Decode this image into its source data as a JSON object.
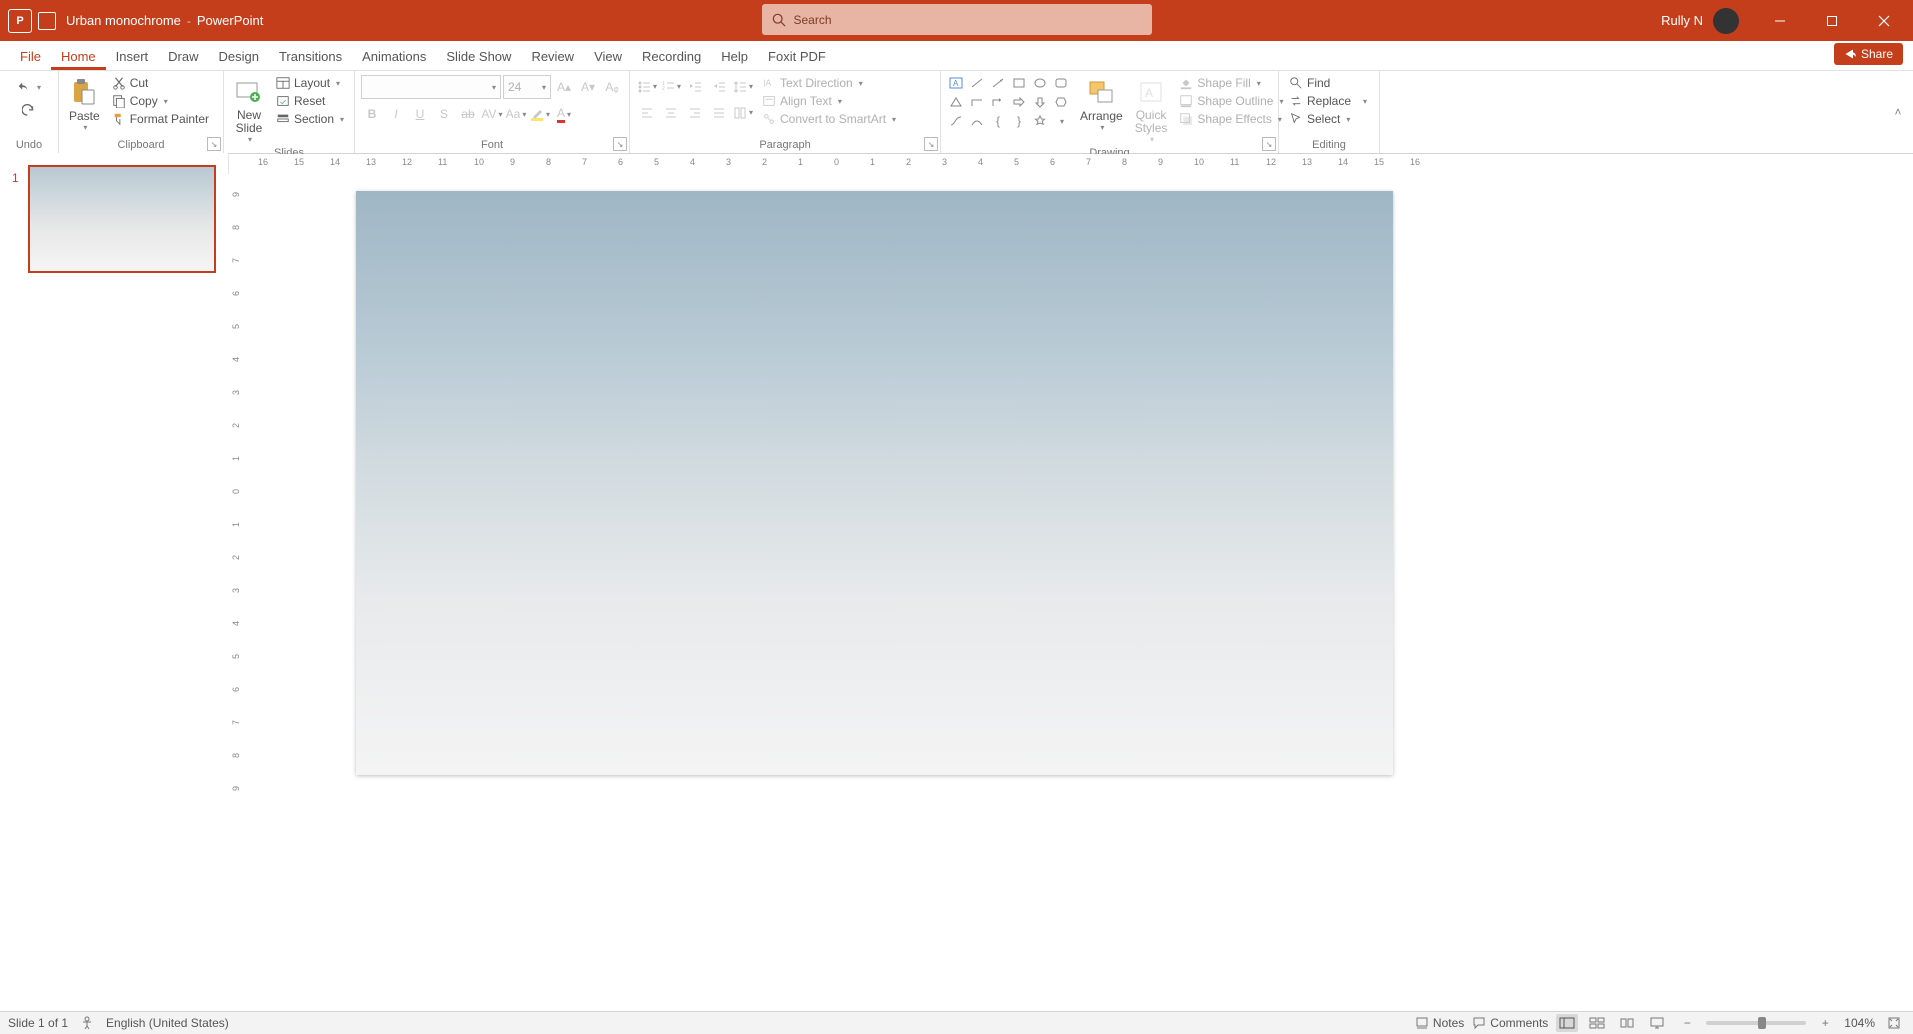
{
  "titlebar": {
    "doc_title": "Urban monochrome",
    "sep": "-",
    "app_name": "PowerPoint",
    "search_placeholder": "Search",
    "user": "Rully N"
  },
  "tabs": {
    "file": "File",
    "home": "Home",
    "insert": "Insert",
    "draw": "Draw",
    "design": "Design",
    "transitions": "Transitions",
    "animations": "Animations",
    "slideshow": "Slide Show",
    "review": "Review",
    "view": "View",
    "recording": "Recording",
    "help": "Help",
    "foxit": "Foxit PDF",
    "share": "Share"
  },
  "ribbon": {
    "undo_label": "Undo",
    "clipboard": {
      "cut": "Cut",
      "copy": "Copy",
      "format_painter": "Format Painter",
      "paste": "Paste",
      "label": "Clipboard"
    },
    "slides": {
      "new_slide": "New\nSlide",
      "layout": "Layout",
      "reset": "Reset",
      "section": "Section",
      "label": "Slides"
    },
    "font": {
      "size": "24",
      "label": "Font"
    },
    "paragraph": {
      "text_direction": "Text Direction",
      "align_text": "Align Text",
      "smartart": "Convert to SmartArt",
      "label": "Paragraph"
    },
    "drawing": {
      "arrange": "Arrange",
      "quick_styles": "Quick\nStyles",
      "shape_fill": "Shape Fill",
      "shape_outline": "Shape Outline",
      "shape_effects": "Shape Effects",
      "label": "Drawing"
    },
    "editing": {
      "find": "Find",
      "replace": "Replace",
      "select": "Select",
      "label": "Editing"
    }
  },
  "hruler_ticks": [
    "16",
    "15",
    "14",
    "13",
    "12",
    "11",
    "10",
    "9",
    "8",
    "7",
    "6",
    "5",
    "4",
    "3",
    "2",
    "1",
    "0",
    "1",
    "2",
    "3",
    "4",
    "5",
    "6",
    "7",
    "8",
    "9",
    "10",
    "11",
    "12",
    "13",
    "14",
    "15",
    "16"
  ],
  "vruler_ticks": [
    "9",
    "8",
    "7",
    "6",
    "5",
    "4",
    "3",
    "2",
    "1",
    "0",
    "1",
    "2",
    "3",
    "4",
    "5",
    "6",
    "7",
    "8",
    "9"
  ],
  "thumb": {
    "num": "1"
  },
  "status": {
    "slide": "Slide 1 of 1",
    "lang": "English (United States)",
    "notes": "Notes",
    "comments": "Comments",
    "zoom": "104%"
  },
  "chart_data": null
}
